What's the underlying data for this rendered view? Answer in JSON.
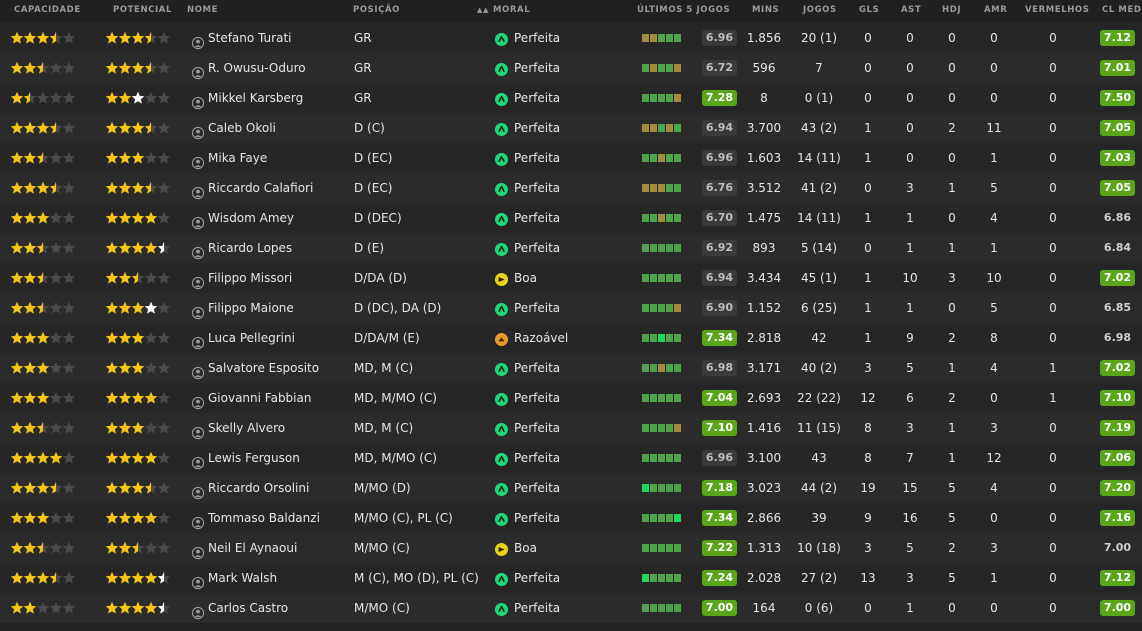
{
  "columns": {
    "ability": "CAPACIDADE",
    "potential": "POTENCIAL",
    "name": "NOME",
    "position": "POSIÇÃO",
    "morale_sort": "▲▲",
    "morale": "MORAL",
    "last5": "ÚLTIMOS 5 JOGOS",
    "mins": "MINS",
    "apps": "JOGOS",
    "gls": "GLS",
    "ast": "AST",
    "pom": "HDJ",
    "yel": "AMR",
    "red": "VERMELHOS",
    "avg": "CL MED"
  },
  "colors": {
    "star_gold": "#f5c518",
    "star_white": "#ffffff",
    "star_empty": "#4a4a4a",
    "morale_perfeita": "#1fd67a",
    "morale_boa": "#e9d21d",
    "morale_razoavel": "#e69a2e",
    "bar_gold": "#a38b3d",
    "bar_green": "#4ea34a",
    "bar_bright": "#23d65a",
    "rating_green": "#5aa51a",
    "rating_dim": "#3a3a3a"
  },
  "players": [
    {
      "ability": 3.5,
      "potential": 3.5,
      "potential_white": 0,
      "name": "Stefano Turati",
      "position": "GR",
      "morale": "Perfeita",
      "morale_type": "perfeita",
      "form": [
        "g",
        "g",
        "gr",
        "gr",
        "gr"
      ],
      "rating5": "6.96",
      "rating5_green": false,
      "mins": "1.856",
      "apps": "20 (1)",
      "gls": "0",
      "ast": "0",
      "pom": "0",
      "yel": "0",
      "red": "0",
      "avg": "7.12",
      "avg_green": true
    },
    {
      "ability": 2.5,
      "potential": 3.5,
      "potential_white": 0,
      "name": "R. Owusu-Oduro",
      "position": "GR",
      "morale": "Perfeita",
      "morale_type": "perfeita",
      "form": [
        "gr",
        "g",
        "gr",
        "gr",
        "g"
      ],
      "rating5": "6.72",
      "rating5_green": false,
      "mins": "596",
      "apps": "7",
      "gls": "0",
      "ast": "0",
      "pom": "0",
      "yel": "0",
      "red": "0",
      "avg": "7.01",
      "avg_green": true
    },
    {
      "ability": 1.5,
      "potential": 2,
      "potential_white": 1,
      "name": "Mikkel Karsberg",
      "position": "GR",
      "morale": "Perfeita",
      "morale_type": "perfeita",
      "form": [
        "gr",
        "gr",
        "gr",
        "gr",
        "g"
      ],
      "rating5": "7.28",
      "rating5_green": true,
      "mins": "8",
      "apps": "0 (1)",
      "gls": "0",
      "ast": "0",
      "pom": "0",
      "yel": "0",
      "red": "0",
      "avg": "7.50",
      "avg_green": true
    },
    {
      "ability": 3.5,
      "potential": 3.5,
      "potential_white": 0,
      "name": "Caleb Okoli",
      "position": "D (C)",
      "morale": "Perfeita",
      "morale_type": "perfeita",
      "form": [
        "g",
        "g",
        "gr",
        "g",
        "gr"
      ],
      "rating5": "6.94",
      "rating5_green": false,
      "mins": "3.700",
      "apps": "43 (2)",
      "gls": "1",
      "ast": "0",
      "pom": "2",
      "yel": "11",
      "red": "0",
      "avg": "7.05",
      "avg_green": true
    },
    {
      "ability": 2.5,
      "potential": 3,
      "potential_white": 0,
      "name": "Mika Faye",
      "position": "D (EC)",
      "morale": "Perfeita",
      "morale_type": "perfeita",
      "form": [
        "gr",
        "gr",
        "g",
        "gr",
        "gr"
      ],
      "rating5": "6.96",
      "rating5_green": false,
      "mins": "1.603",
      "apps": "14 (11)",
      "gls": "1",
      "ast": "0",
      "pom": "0",
      "yel": "1",
      "red": "0",
      "avg": "7.03",
      "avg_green": true
    },
    {
      "ability": 3.5,
      "potential": 3.5,
      "potential_white": 0,
      "name": "Riccardo Calafiori",
      "position": "D (EC)",
      "morale": "Perfeita",
      "morale_type": "perfeita",
      "form": [
        "g",
        "g",
        "g",
        "gr",
        "gr"
      ],
      "rating5": "6.76",
      "rating5_green": false,
      "mins": "3.512",
      "apps": "41 (2)",
      "gls": "0",
      "ast": "3",
      "pom": "1",
      "yel": "5",
      "red": "0",
      "avg": "7.05",
      "avg_green": true
    },
    {
      "ability": 3,
      "potential": 4,
      "potential_white": 0,
      "name": "Wisdom Amey",
      "position": "D (DEC)",
      "morale": "Perfeita",
      "morale_type": "perfeita",
      "form": [
        "gr",
        "gr",
        "g",
        "gr",
        "gr"
      ],
      "rating5": "6.70",
      "rating5_green": false,
      "mins": "1.475",
      "apps": "14 (11)",
      "gls": "1",
      "ast": "1",
      "pom": "0",
      "yel": "4",
      "red": "0",
      "avg": "6.86",
      "avg_green": false
    },
    {
      "ability": 2.5,
      "potential": 4,
      "potential_white": 0.5,
      "name": "Ricardo Lopes",
      "position": "D (E)",
      "morale": "Perfeita",
      "morale_type": "perfeita",
      "form": [
        "gr",
        "gr",
        "gr",
        "gr",
        "gr"
      ],
      "rating5": "6.92",
      "rating5_green": false,
      "mins": "893",
      "apps": "5 (14)",
      "gls": "0",
      "ast": "1",
      "pom": "1",
      "yel": "1",
      "red": "0",
      "avg": "6.84",
      "avg_green": false
    },
    {
      "ability": 2.5,
      "potential": 2.5,
      "potential_white": 0,
      "name": "Filippo Missori",
      "position": "D/DA (D)",
      "morale": "Boa",
      "morale_type": "boa",
      "form": [
        "gr",
        "gr",
        "gr",
        "gr",
        "gr"
      ],
      "rating5": "6.94",
      "rating5_green": false,
      "mins": "3.434",
      "apps": "45 (1)",
      "gls": "1",
      "ast": "10",
      "pom": "3",
      "yel": "10",
      "red": "0",
      "avg": "7.02",
      "avg_green": true
    },
    {
      "ability": 2.5,
      "potential": 3,
      "potential_white": 1,
      "name": "Filippo Maione",
      "position": "D (DC), DA (D)",
      "morale": "Perfeita",
      "morale_type": "perfeita",
      "form": [
        "gr",
        "gr",
        "gr",
        "gr",
        "g"
      ],
      "rating5": "6.90",
      "rating5_green": false,
      "mins": "1.152",
      "apps": "6 (25)",
      "gls": "1",
      "ast": "1",
      "pom": "0",
      "yel": "5",
      "red": "0",
      "avg": "6.85",
      "avg_green": false
    },
    {
      "ability": 3,
      "potential": 3,
      "potential_white": 0,
      "name": "Luca Pellegrini",
      "position": "D/DA/M (E)",
      "morale": "Razoável",
      "morale_type": "razoavel",
      "form": [
        "gr",
        "gr",
        "br",
        "gr",
        "gr"
      ],
      "rating5": "7.34",
      "rating5_green": true,
      "mins": "2.818",
      "apps": "42",
      "gls": "1",
      "ast": "9",
      "pom": "2",
      "yel": "8",
      "red": "0",
      "avg": "6.98",
      "avg_green": false
    },
    {
      "ability": 3,
      "potential": 3,
      "potential_white": 0,
      "name": "Salvatore Esposito",
      "position": "MD, M (C)",
      "morale": "Perfeita",
      "morale_type": "perfeita",
      "form": [
        "gr",
        "gr",
        "g",
        "gr",
        "gr"
      ],
      "rating5": "6.98",
      "rating5_green": false,
      "mins": "3.171",
      "apps": "40 (2)",
      "gls": "3",
      "ast": "5",
      "pom": "1",
      "yel": "4",
      "red": "1",
      "avg": "7.02",
      "avg_green": true
    },
    {
      "ability": 3,
      "potential": 4,
      "potential_white": 0,
      "name": "Giovanni Fabbian",
      "position": "MD, M/MO (C)",
      "morale": "Perfeita",
      "morale_type": "perfeita",
      "form": [
        "gr",
        "gr",
        "gr",
        "gr",
        "gr"
      ],
      "rating5": "7.04",
      "rating5_green": true,
      "mins": "2.693",
      "apps": "22 (22)",
      "gls": "12",
      "ast": "6",
      "pom": "2",
      "yel": "0",
      "red": "1",
      "avg": "7.10",
      "avg_green": true
    },
    {
      "ability": 2.5,
      "potential": 3,
      "potential_white": 0,
      "name": "Skelly Alvero",
      "position": "MD, M (C)",
      "morale": "Perfeita",
      "morale_type": "perfeita",
      "form": [
        "gr",
        "gr",
        "gr",
        "gr",
        "g"
      ],
      "rating5": "7.10",
      "rating5_green": true,
      "mins": "1.416",
      "apps": "11 (15)",
      "gls": "8",
      "ast": "3",
      "pom": "1",
      "yel": "3",
      "red": "0",
      "avg": "7.19",
      "avg_green": true
    },
    {
      "ability": 4,
      "potential": 4,
      "potential_white": 0,
      "name": "Lewis Ferguson",
      "position": "MD, M/MO (C)",
      "morale": "Perfeita",
      "morale_type": "perfeita",
      "form": [
        "gr",
        "gr",
        "gr",
        "gr",
        "gr"
      ],
      "rating5": "6.96",
      "rating5_green": false,
      "mins": "3.100",
      "apps": "43",
      "gls": "8",
      "ast": "7",
      "pom": "1",
      "yel": "12",
      "red": "0",
      "avg": "7.06",
      "avg_green": true
    },
    {
      "ability": 3.5,
      "potential": 3.5,
      "potential_white": 0,
      "name": "Riccardo Orsolini",
      "position": "M/MO (D)",
      "morale": "Perfeita",
      "morale_type": "perfeita",
      "form": [
        "br",
        "gr",
        "gr",
        "gr",
        "gr"
      ],
      "rating5": "7.18",
      "rating5_green": true,
      "mins": "3.023",
      "apps": "44 (2)",
      "gls": "19",
      "ast": "15",
      "pom": "5",
      "yel": "4",
      "red": "0",
      "avg": "7.20",
      "avg_green": true
    },
    {
      "ability": 3,
      "potential": 4,
      "potential_white": 0,
      "name": "Tommaso Baldanzi",
      "position": "M/MO (C), PL (C)",
      "morale": "Perfeita",
      "morale_type": "perfeita",
      "form": [
        "gr",
        "gr",
        "gr",
        "gr",
        "br"
      ],
      "rating5": "7.34",
      "rating5_green": true,
      "mins": "2.866",
      "apps": "39",
      "gls": "9",
      "ast": "16",
      "pom": "5",
      "yel": "0",
      "red": "0",
      "avg": "7.16",
      "avg_green": true
    },
    {
      "ability": 2.5,
      "potential": 2.5,
      "potential_white": 0,
      "name": "Neil El Aynaoui",
      "position": "M/MO (C)",
      "morale": "Boa",
      "morale_type": "boa",
      "form": [
        "gr",
        "gr",
        "gr",
        "gr",
        "gr"
      ],
      "rating5": "7.22",
      "rating5_green": true,
      "mins": "1.313",
      "apps": "10 (18)",
      "gls": "3",
      "ast": "5",
      "pom": "2",
      "yel": "3",
      "red": "0",
      "avg": "7.00",
      "avg_green": false
    },
    {
      "ability": 3.5,
      "potential": 4,
      "potential_white": 0.5,
      "name": "Mark Walsh",
      "position": "M (C), MO (D), PL (C)",
      "morale": "Perfeita",
      "morale_type": "perfeita",
      "form": [
        "br",
        "gr",
        "gr",
        "gr",
        "gr"
      ],
      "rating5": "7.24",
      "rating5_green": true,
      "mins": "2.028",
      "apps": "27 (2)",
      "gls": "13",
      "ast": "3",
      "pom": "5",
      "yel": "1",
      "red": "0",
      "avg": "7.12",
      "avg_green": true
    },
    {
      "ability": 2,
      "potential": 4,
      "potential_white": 0.5,
      "name": "Carlos Castro",
      "position": "M/MO (C)",
      "morale": "Perfeita",
      "morale_type": "perfeita",
      "form": [
        "gr",
        "gr",
        "gr",
        "gr",
        "gr"
      ],
      "rating5": "7.00",
      "rating5_green": true,
      "mins": "164",
      "apps": "0 (6)",
      "gls": "0",
      "ast": "1",
      "pom": "0",
      "yel": "0",
      "red": "0",
      "avg": "7.00",
      "avg_green": true
    }
  ]
}
